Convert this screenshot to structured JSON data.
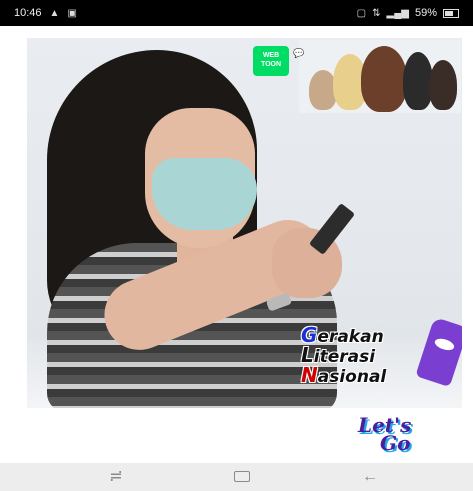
{
  "status_bar": {
    "time": "10:46",
    "left_icons": [
      "warning-icon",
      "image-icon"
    ],
    "right_text": "59%",
    "right_icons": [
      "notification-icon",
      "network-4g-icon",
      "signal-icon",
      "battery-icon"
    ],
    "battery_level": 0.59
  },
  "poster": {
    "webtoon_logo": "WEB TOON",
    "webtoon_bubble": "..",
    "gln_lines": [
      {
        "initial": "G",
        "rest": "erakan"
      },
      {
        "initial": "L",
        "rest": "iterasi"
      },
      {
        "initial": "N",
        "rest": "asional"
      }
    ],
    "letsgo_line1": "Let's",
    "letsgo_line2": "Go"
  },
  "nav_bar": {
    "buttons": [
      "menu-icon",
      "home-recents-icon",
      "back-icon"
    ],
    "back_glyph": "←",
    "menu_glyph": "≓"
  }
}
